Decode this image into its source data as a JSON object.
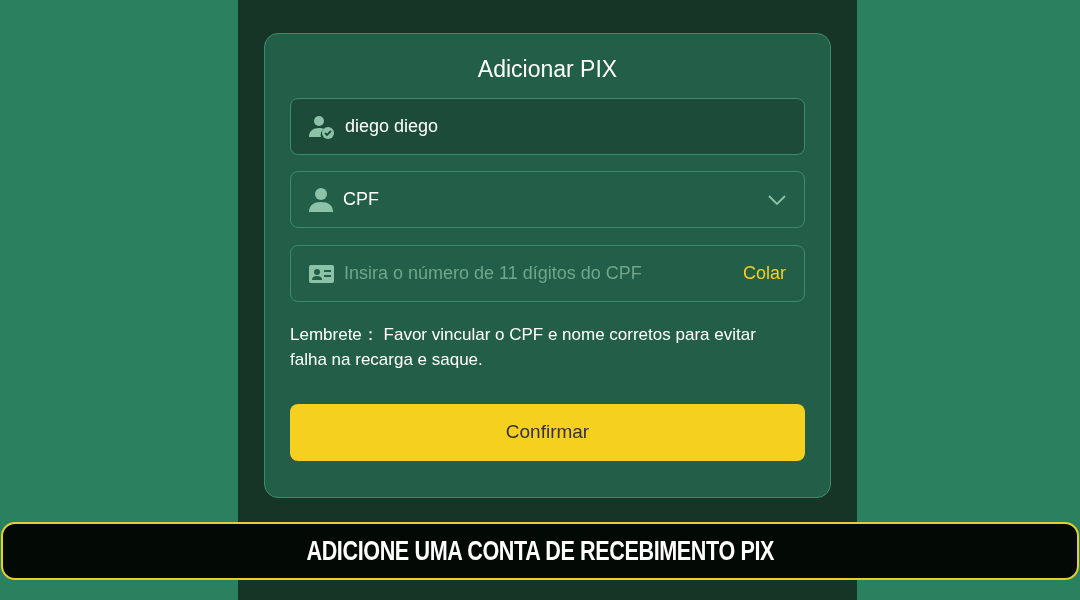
{
  "dialog": {
    "title": "Adicionar PIX",
    "fields": [
      {
        "kind": "value",
        "value": "diego diego"
      },
      {
        "kind": "select",
        "value": "CPF"
      },
      {
        "kind": "input",
        "placeholder": "Insira o número de 11 dígitos do CPF",
        "action": "Colar"
      }
    ],
    "reminder": "Lembrete： Favor vincular o CPF e nome corretos para evitar falha na recarga e saque.",
    "confirm_button": "Confirmar"
  },
  "caption": "ADICIONE UMA CONTA DE RECEBIMENTO PIX"
}
